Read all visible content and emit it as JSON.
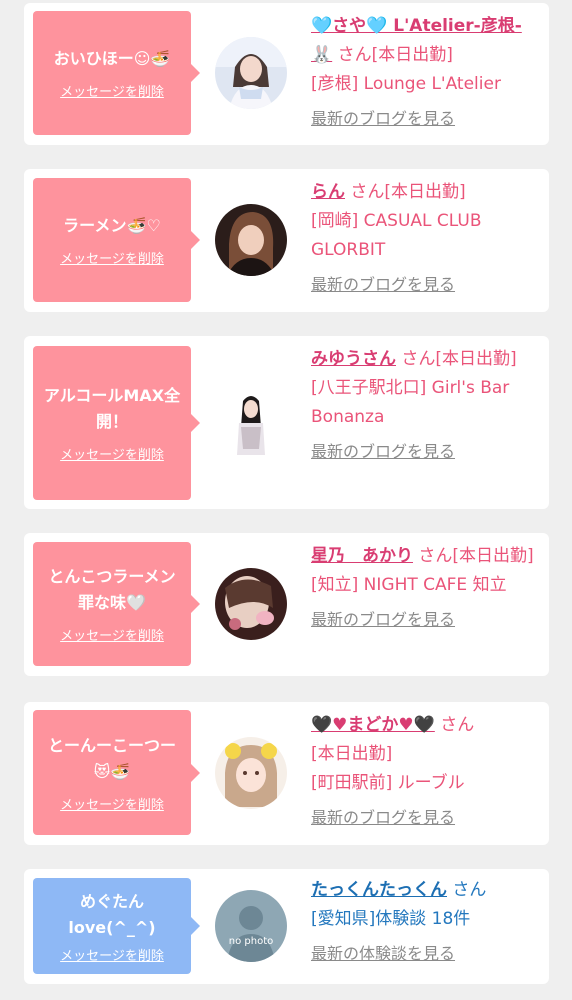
{
  "cards": [
    {
      "bubble_message": "おいひほー☺🍜",
      "delete_label": "メッセージを削除",
      "name": "🩵さや🩵 L'Atelier-彦根-🐰",
      "suffix": "さん[本日出勤]",
      "store": "[彦根] Lounge L'Atelier",
      "latest_link": "最新のブログを見る"
    },
    {
      "bubble_message": "ラーメン🍜♡",
      "delete_label": "メッセージを削除",
      "name": "らん",
      "suffix": "さん[本日出勤]",
      "store": "[岡崎] CASUAL CLUB GLORBIT",
      "latest_link": "最新のブログを見る"
    },
    {
      "bubble_message": "アルコールMAX全開！",
      "delete_label": "メッセージを削除",
      "name": "みゆうさん",
      "suffix": "さん[本日出勤]",
      "store": "[八王子駅北口] Girl's Bar Bonanza",
      "latest_link": "最新のブログを見る"
    },
    {
      "bubble_message": "とんこつラーメン罪な味🤍",
      "delete_label": "メッセージを削除",
      "name": "星乃　あかり",
      "suffix": "さん[本日出勤]",
      "store": "[知立] NIGHT CAFE 知立",
      "latest_link": "最新のブログを見る"
    },
    {
      "bubble_message": "とーんーこーつー😻🍜",
      "delete_label": "メッセージを削除",
      "name": "🖤♥まどか♥🖤",
      "suffix": "さん",
      "status": "[本日出勤]",
      "store": "[町田駅前] ルーブル",
      "latest_link": "最新のブログを見る"
    },
    {
      "bubble_message": "めぐたんlove(^_^)",
      "delete_label": "メッセージを削除",
      "name": "たっくんたっくん",
      "suffix": "さん",
      "store": "[愛知県]体験談 18件",
      "latest_link": "最新の体験談を見る",
      "avatar_text": "no photo"
    }
  ],
  "colors": {
    "bubble_pink": "#fe939d",
    "bubble_blue": "#8eb8f5",
    "name_pink": "#d93d72",
    "name_blue": "#1d6fb3",
    "link_gray": "#8a8a8a"
  }
}
